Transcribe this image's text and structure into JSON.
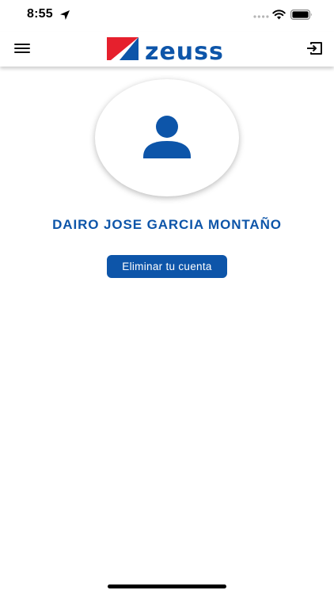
{
  "status_bar": {
    "time": "8:55",
    "icons": [
      "location-arrow-icon",
      "signal-icon",
      "wifi-icon",
      "battery-icon"
    ]
  },
  "header": {
    "menu_icon": "hamburger-menu-icon",
    "logo_text": "zeuss",
    "logout_icon": "logout-icon"
  },
  "profile": {
    "avatar_icon": "user-icon",
    "name": "DAIRO JOSE GARCIA MONTAÑO",
    "delete_button_label": "Eliminar tu cuenta"
  },
  "colors": {
    "brand_blue": "#0d55a9",
    "brand_red": "#e6202d",
    "background": "#ffffff"
  }
}
